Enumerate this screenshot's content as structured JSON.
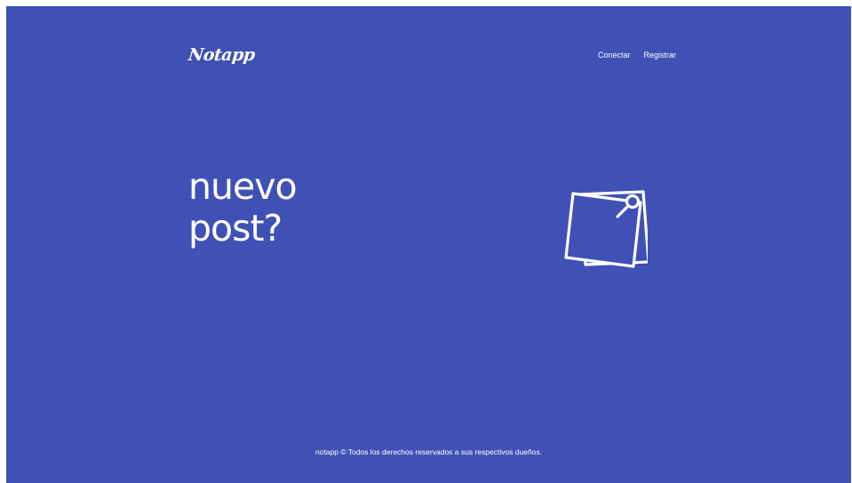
{
  "header": {
    "logo": "Notapp",
    "nav": [
      {
        "label": "Conectar"
      },
      {
        "label": "Registrar"
      }
    ]
  },
  "hero": {
    "title_line1": "nuevo",
    "title_line2": "post?",
    "illustration_icon": "sticky-notes-icon"
  },
  "footer": {
    "text": "notapp © Todos los derechos reservados a sus respectivos dueños."
  },
  "colors": {
    "background": "#3f51b5",
    "foreground": "#ffffff"
  }
}
